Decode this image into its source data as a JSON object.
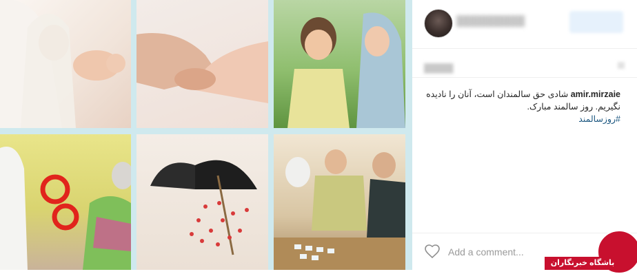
{
  "post": {
    "caption": {
      "username": "amir.mirzaie",
      "line1": "شادی حق سالمندان است، آنان را نادیده",
      "line2": "نگیریم. روز سالمند مبارک.",
      "hashtag": "#روزسالمند"
    }
  },
  "comment": {
    "placeholder": "Add a comment..."
  },
  "watermark": {
    "label": "باشگاه خبرنگاران"
  },
  "colors": {
    "collage_border": "#cfe9ee",
    "hashtag": "#1c5780",
    "watermark": "#c8102e"
  }
}
